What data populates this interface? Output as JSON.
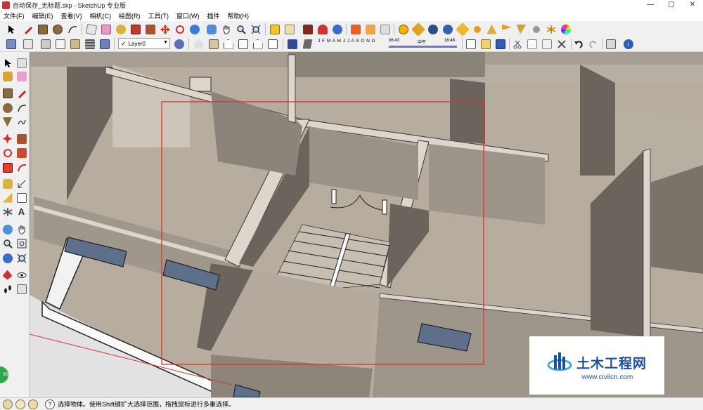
{
  "window": {
    "title": "自动保存_无标题.skp - SketchUp 专业版",
    "minimize": "—",
    "maximize": "▢",
    "close": "✕"
  },
  "menu": [
    {
      "label": "文件(F)"
    },
    {
      "label": "编辑(E)"
    },
    {
      "label": "查看(V)"
    },
    {
      "label": "相机(C)"
    },
    {
      "label": "绘图(R)"
    },
    {
      "label": "工具(T)"
    },
    {
      "label": "窗口(W)"
    },
    {
      "label": "插件"
    },
    {
      "label": "帮助(H)"
    }
  ],
  "layers": {
    "current": "Layer0",
    "check": "✓"
  },
  "shadows": {
    "months": "J F M A M J J A S O N D",
    "time_start": "06:43",
    "time_mid": "中午",
    "time_end": "16:46"
  },
  "status": {
    "text": "选择物体。使用Shift键扩大选择范围，拖拽鼠标进行多重选择。",
    "badge": "65"
  },
  "watermark": {
    "title": "土木工程网",
    "url": "www.civilcn.com"
  },
  "colors": {
    "accent_selection": "#e0302a",
    "wall_top": "#ddd6cd",
    "floor": "#b6ad9f",
    "wall_shadow": "#5d574f",
    "window_glass": "#5d6f8a",
    "watermark_blue": "#1d4f9c"
  }
}
